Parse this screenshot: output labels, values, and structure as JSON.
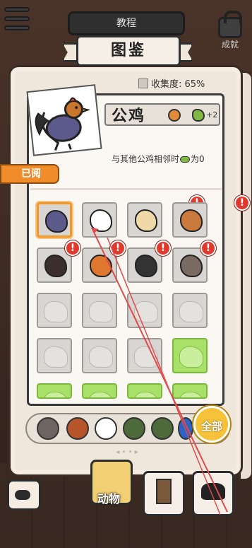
{
  "header": {
    "tutorial_label": "教程",
    "achievement_label": "成就"
  },
  "book": {
    "title": "图鉴",
    "collection_label": "收集度: 65%"
  },
  "entry": {
    "name": "公鸡",
    "bonus": "+2",
    "description": "与其他公鸡相邻时",
    "description_suffix": "为0",
    "status_tab": "已阅"
  },
  "grid": {
    "rows": [
      [
        "rooster",
        "hen",
        "owl",
        "chicken"
      ],
      [
        "turkey",
        "fox",
        "skunk",
        "wolf"
      ],
      [
        "locked",
        "locked",
        "locked",
        "locked"
      ],
      [
        "locked",
        "locked",
        "locked",
        "green"
      ],
      [
        "green",
        "green",
        "green",
        "green"
      ]
    ]
  },
  "categories": [
    "bird",
    "snail",
    "ghost",
    "locked",
    "locked",
    "locked"
  ],
  "all_label": "全部",
  "bottom_nav": {
    "animals_label": "动物"
  }
}
